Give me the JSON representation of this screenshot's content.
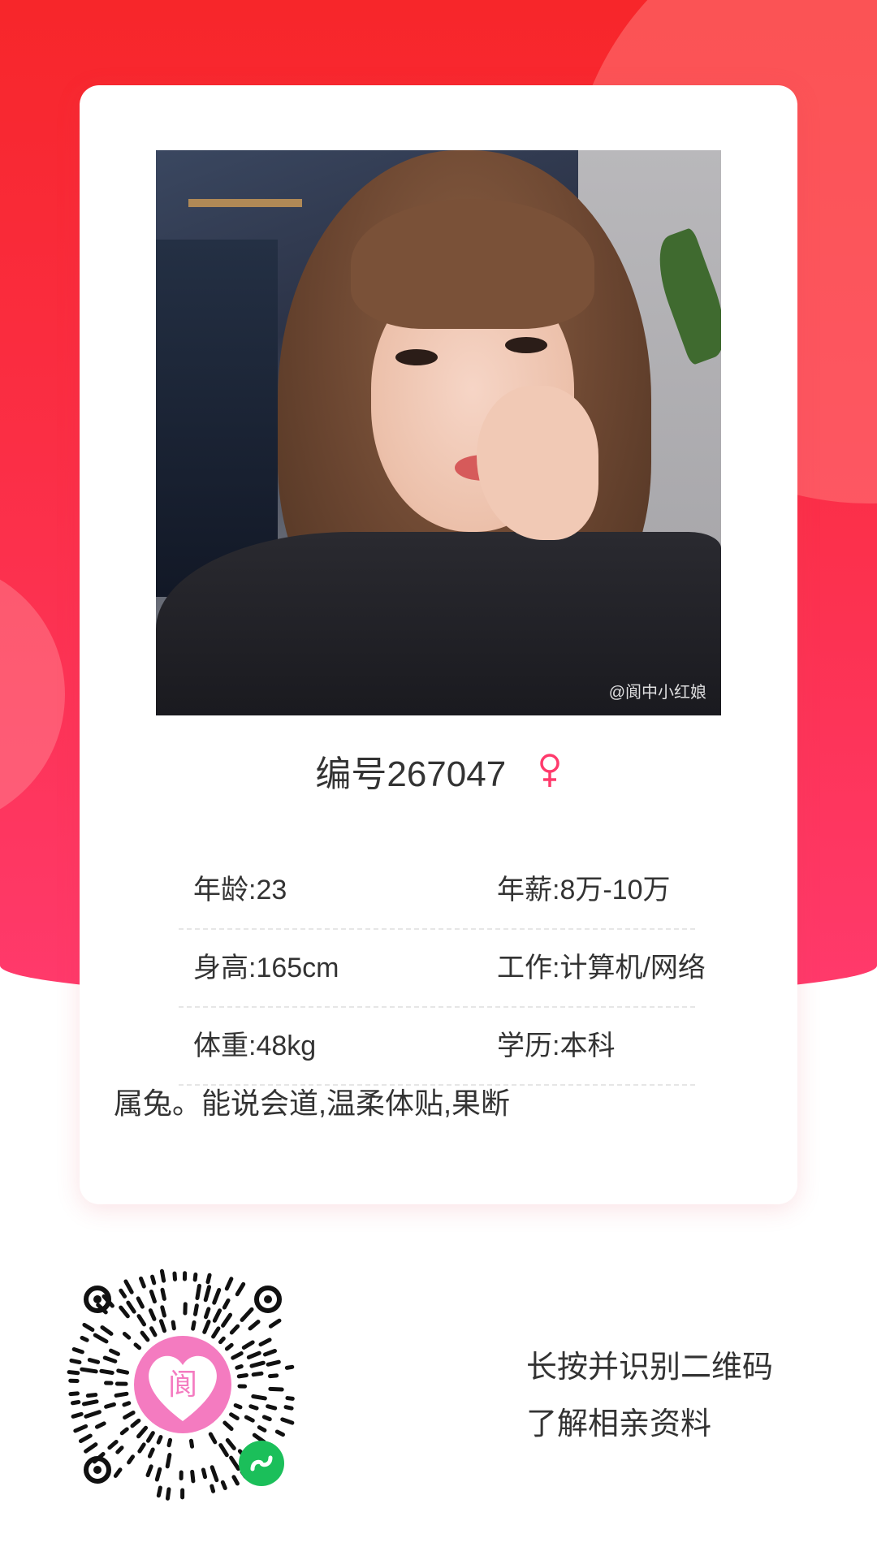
{
  "theme": {
    "accent": "#fb2e45",
    "gender_color": "#ff3a6c"
  },
  "profile": {
    "watermark": "@阆中小红娘",
    "number": "编号267047",
    "gender_icon": "female-symbol-icon"
  },
  "info": {
    "age": "年龄:23",
    "salary": "年薪:8万-10万",
    "height": "身高:165cm",
    "job": "工作:计算机/网络",
    "weight": "体重:48kg",
    "education": "学历:本科",
    "description": "属兔。能说会道,温柔体贴,果断"
  },
  "footer": {
    "qr_logo_char": "阆",
    "cta_line1": "长按并识别二维码",
    "cta_line2": "了解相亲资料"
  }
}
